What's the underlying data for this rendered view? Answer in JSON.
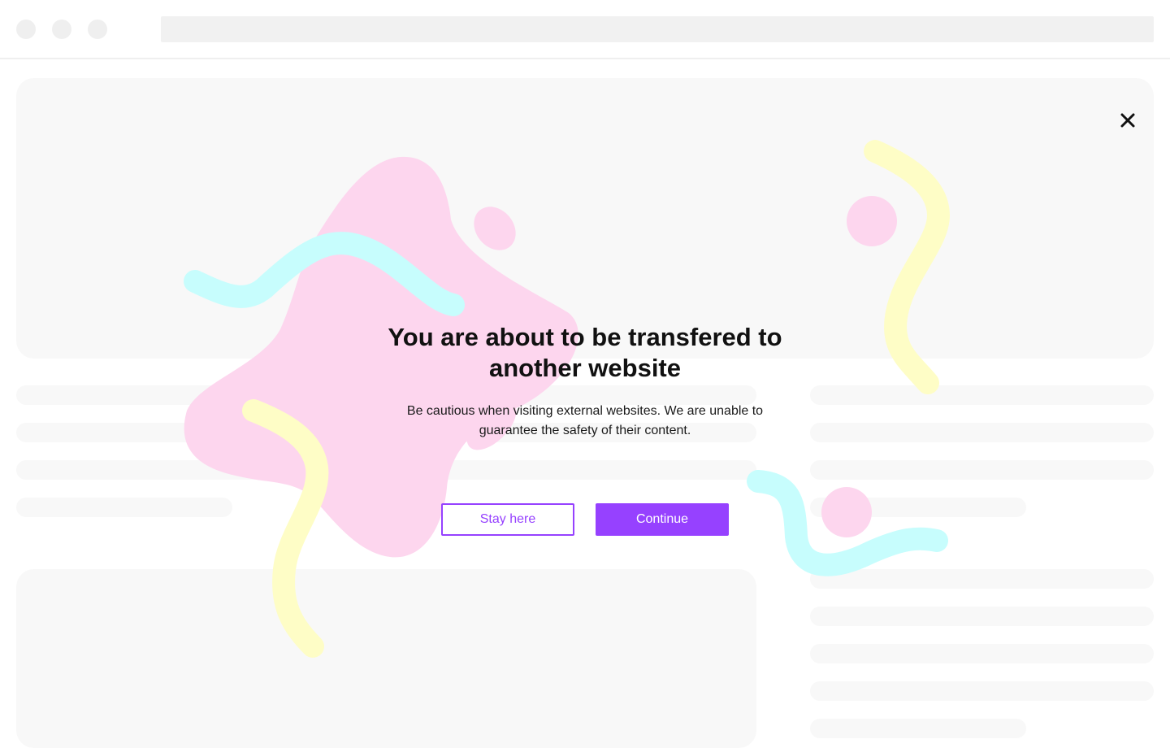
{
  "dialog": {
    "title": "You are about to be transfered to another website",
    "description": "Be cautious when visiting external websites. We are unable to guarantee the safety of their content.",
    "stay_label": "Stay here",
    "continue_label": "Continue"
  },
  "colors": {
    "accent": "#9641ff",
    "blob_pink": "#fdd6ee",
    "squiggle_cyan": "#c7fdfd",
    "squiggle_yellow": "#fefdc6",
    "skeleton": "#f8f8f8",
    "chrome": "#efefef"
  },
  "icons": {
    "close": "close-icon"
  }
}
